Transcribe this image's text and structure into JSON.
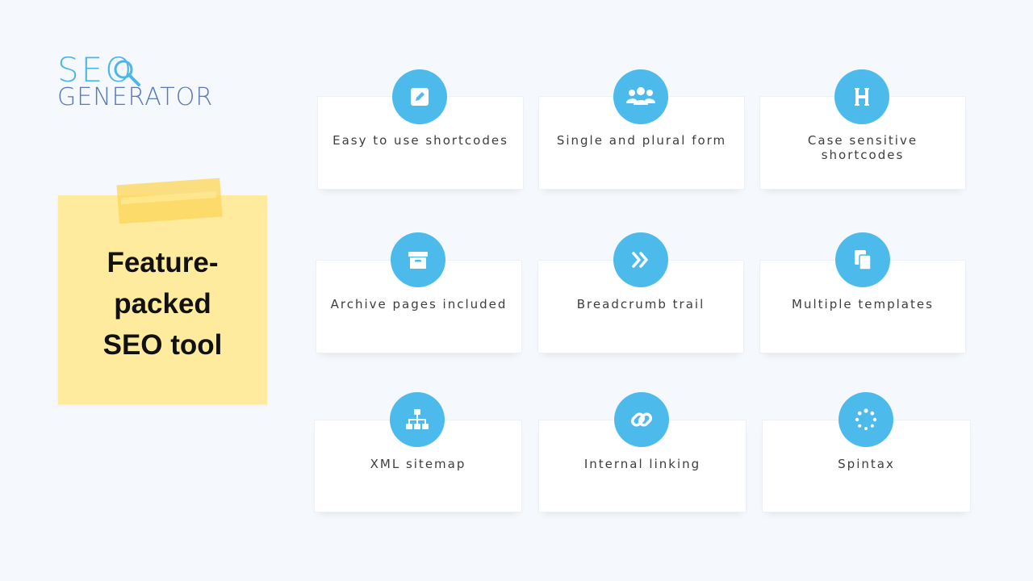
{
  "logo": {
    "line1": "SEO",
    "line2": "GENERATOR"
  },
  "note": {
    "title": "Feature-packed SEO tool"
  },
  "features": [
    {
      "label": "Easy to use shortcodes",
      "icon": "edit-icon"
    },
    {
      "label": "Single and plural form",
      "icon": "users-icon"
    },
    {
      "label": "Case sensitive shortcodes",
      "icon": "heading-icon"
    },
    {
      "label": "Archive pages included",
      "icon": "archive-icon"
    },
    {
      "label": "Breadcrumb trail",
      "icon": "double-chevron-icon"
    },
    {
      "label": "Multiple templates",
      "icon": "copy-icon"
    },
    {
      "label": "XML sitemap",
      "icon": "sitemap-icon"
    },
    {
      "label": "Internal linking",
      "icon": "link-icon"
    },
    {
      "label": "Spintax",
      "icon": "spinner-icon"
    }
  ],
  "colors": {
    "background": "#f5f8fd",
    "accent": "#4cbbeb",
    "logo_primary": "#4ab7e6",
    "logo_secondary": "#5a79b6",
    "note": "#ffeb9e",
    "tape": "#fdd65c"
  }
}
